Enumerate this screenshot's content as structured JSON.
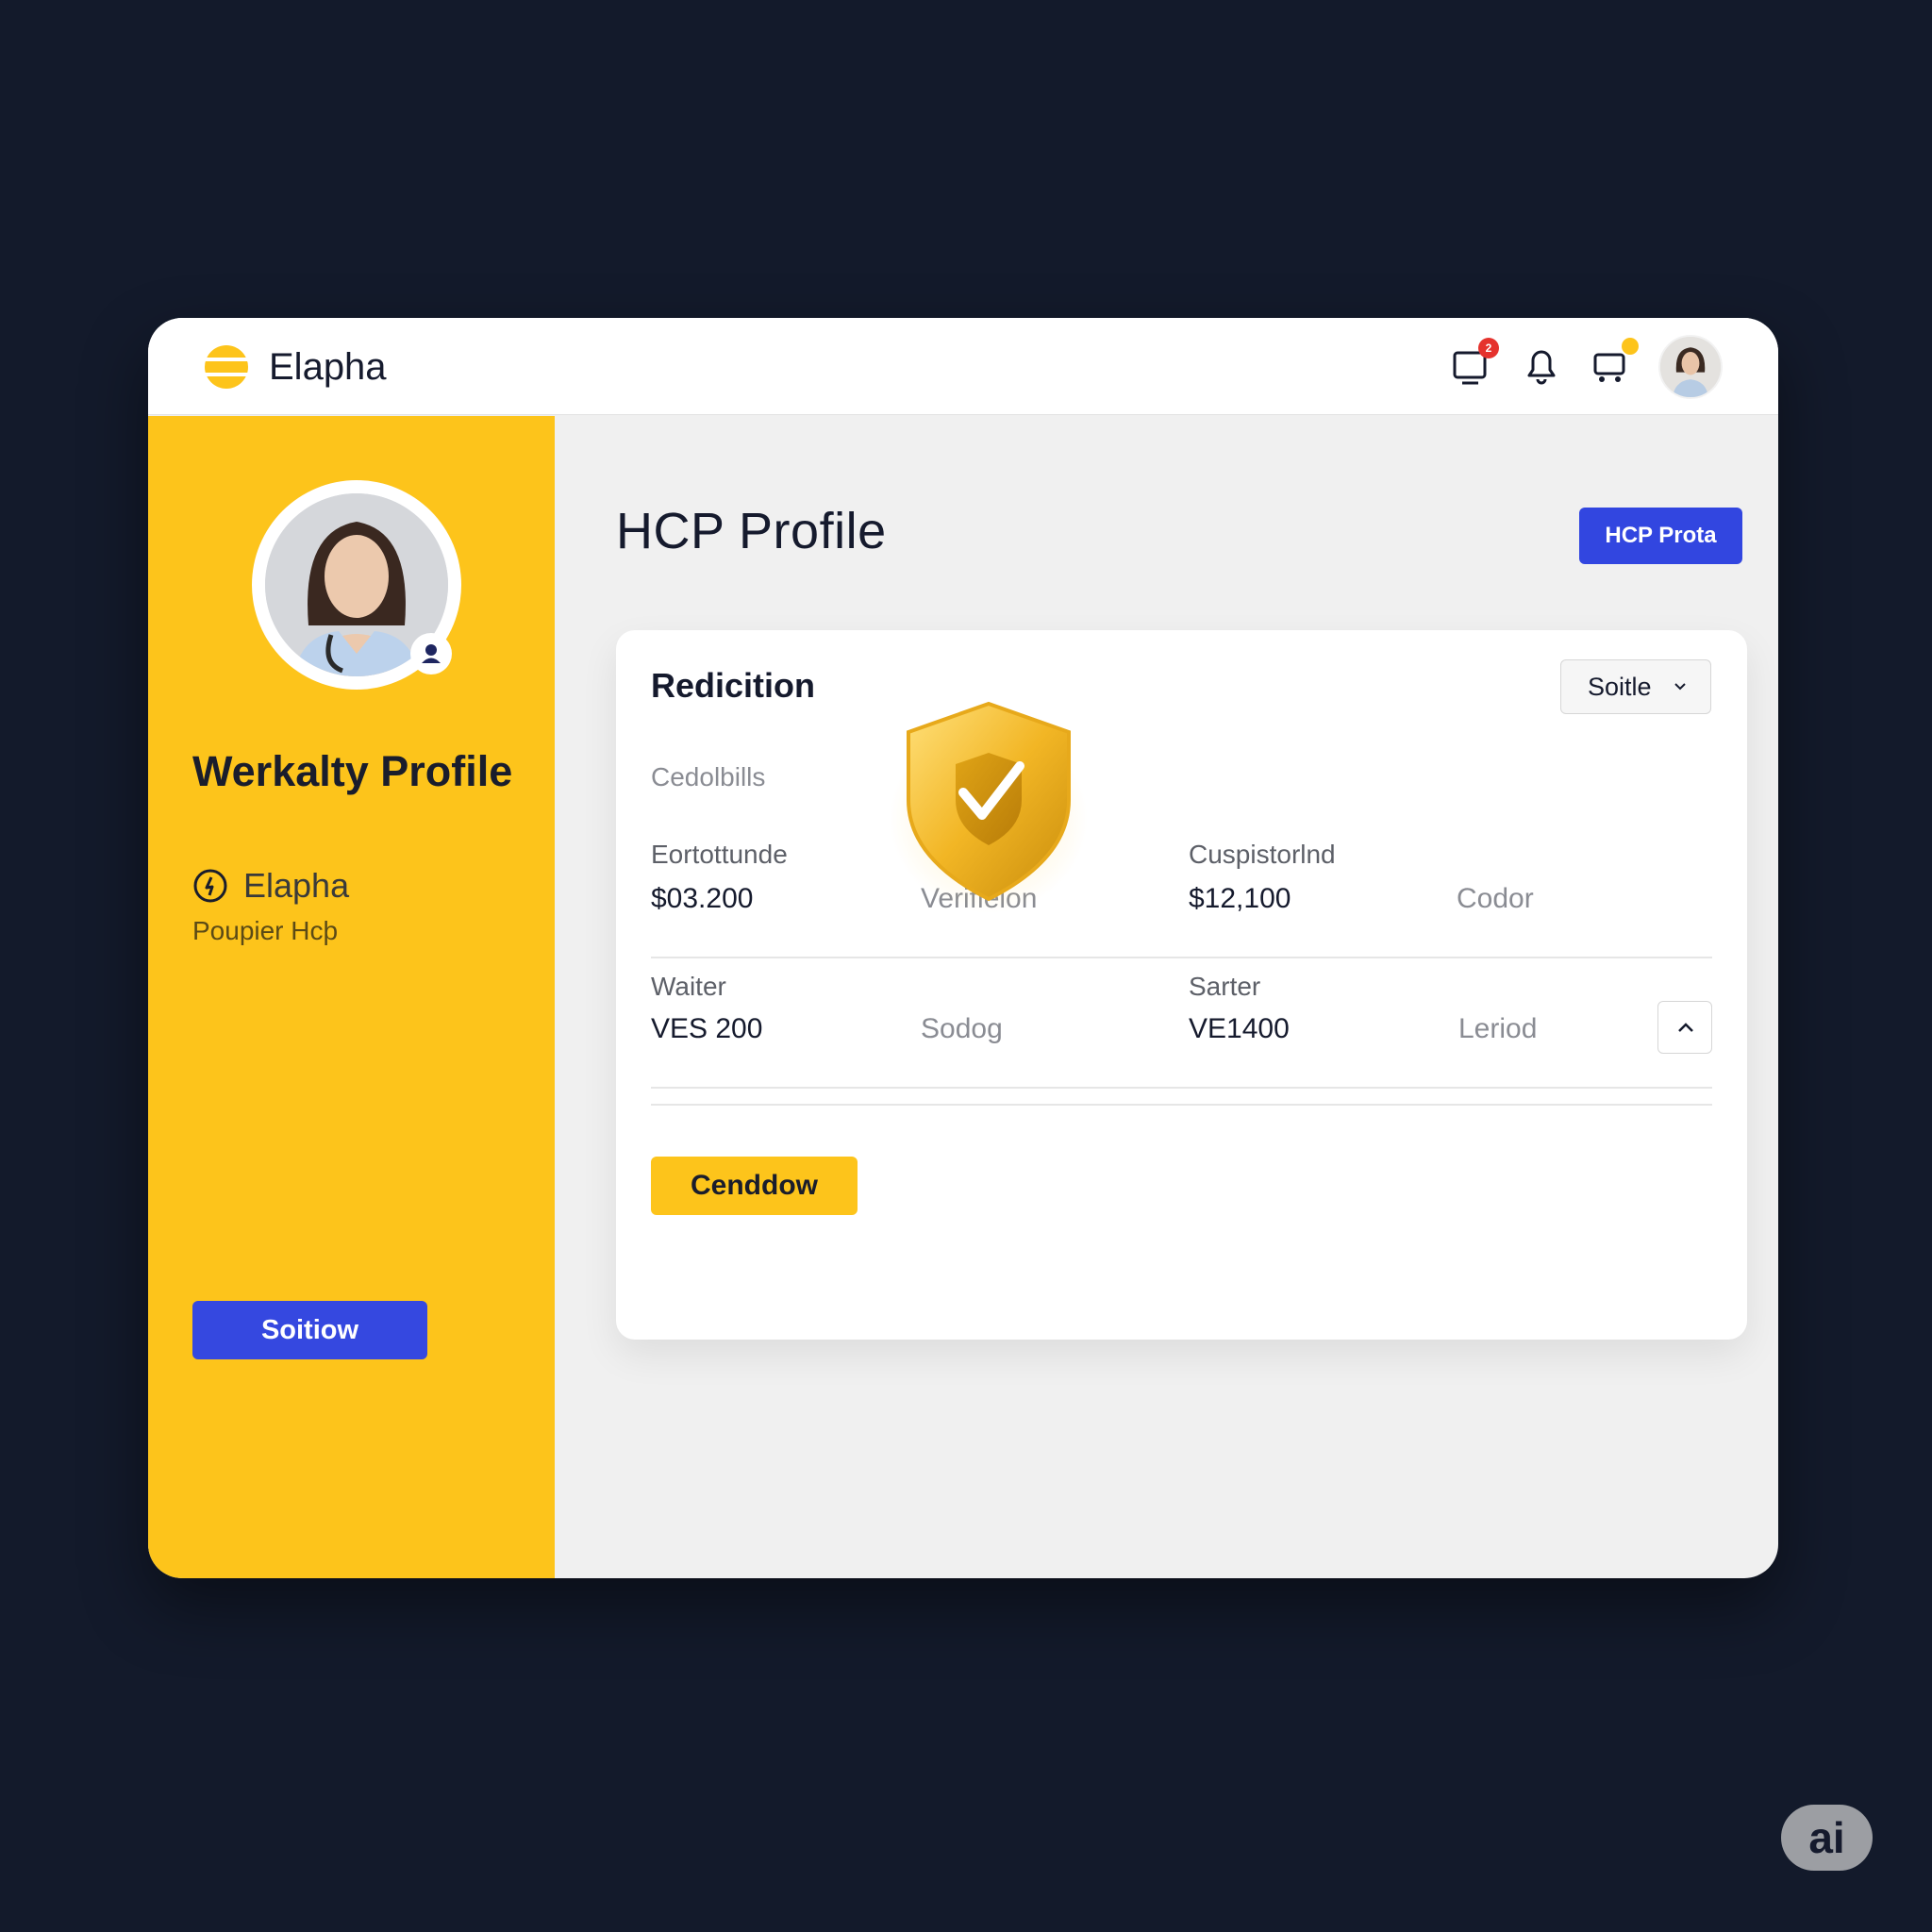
{
  "app": {
    "name": "Elapha"
  },
  "header": {
    "icons": [
      {
        "name": "monitor-alert-icon",
        "badge": "2",
        "badge_color": "#e5322d"
      },
      {
        "name": "bell-icon"
      },
      {
        "name": "cart-icon",
        "badge_color": "#fdc41b"
      }
    ]
  },
  "sidebar": {
    "title": "Werkalty Profile",
    "org": "Elapha",
    "subtitle": "Poupier Hcþ",
    "button_label": "Soitiow",
    "accent": "#fdc41b"
  },
  "main": {
    "title": "HCP Profile",
    "top_button_label": "HCP Prota"
  },
  "card": {
    "title": "Redicition",
    "select_label": "Soitle",
    "top_label": "Cedolbills",
    "overlay_label": "Verifieion",
    "rows": [
      {
        "c1_label": "Eortottunde",
        "c1_value": "$03.200",
        "c2_label": "Cuspistorlnd",
        "c2_value": "$12,100",
        "c3": "Codor"
      },
      {
        "c1_label": "Waiter",
        "c1_value": "VES 200",
        "c1b": "Sodog",
        "c2_label": "Sarter",
        "c2_value": "VE1400",
        "c3": "Leriod"
      }
    ],
    "action_label": "Cenddow"
  },
  "watermark": "ai",
  "colors": {
    "primary": "#3548e0",
    "yellow": "#fdc41b",
    "background": "#131a2b"
  }
}
